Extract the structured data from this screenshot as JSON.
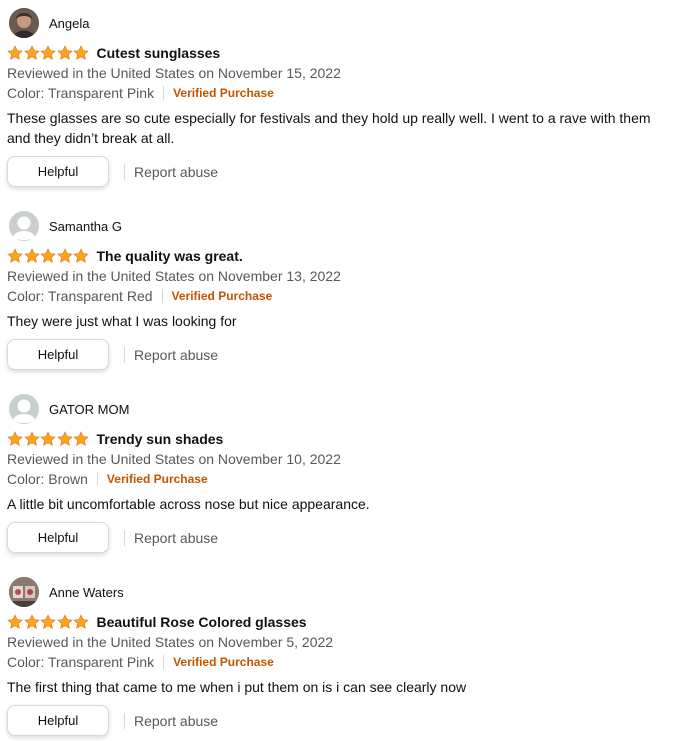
{
  "star_color": "#ffa41c",
  "verified_color": "#c45500",
  "reviews": [
    {
      "name": "Angela",
      "avatar": "user-photo",
      "rating": 5,
      "title": "Cutest sunglasses",
      "date": "Reviewed in the United States on November 15, 2022",
      "color": "Color: Transparent Pink",
      "verified": "Verified Purchase",
      "body": "These glasses are so cute especially for festivals and they hold up really well. I went to a rave with them and they didn’t break at all.",
      "helpful": "Helpful",
      "report": "Report abuse"
    },
    {
      "name": "Samantha G",
      "avatar": "default-user-icon",
      "rating": 5,
      "title": "The quality was great.",
      "date": "Reviewed in the United States on November 13, 2022",
      "color": "Color: Transparent Red",
      "verified": "Verified Purchase",
      "body": "They were just what I was looking for",
      "helpful": "Helpful",
      "report": "Report abuse"
    },
    {
      "name": "GATOR MOM",
      "avatar": "default-user-icon",
      "rating": 5,
      "title": "Trendy sun shades",
      "date": "Reviewed in the United States on November 10, 2022",
      "color": "Color: Brown",
      "verified": "Verified Purchase",
      "body": "A little bit uncomfortable across nose but nice appearance.",
      "helpful": "Helpful",
      "report": "Report abuse"
    },
    {
      "name": "Anne Waters",
      "avatar": "user-photo",
      "rating": 5,
      "title": "Beautiful Rose Colored glasses",
      "date": "Reviewed in the United States on November 5, 2022",
      "color": "Color: Transparent Pink",
      "verified": "Verified Purchase",
      "body": "The first thing that came to me when i put them on is i can see clearly now",
      "helpful": "Helpful",
      "report": "Report abuse"
    }
  ]
}
